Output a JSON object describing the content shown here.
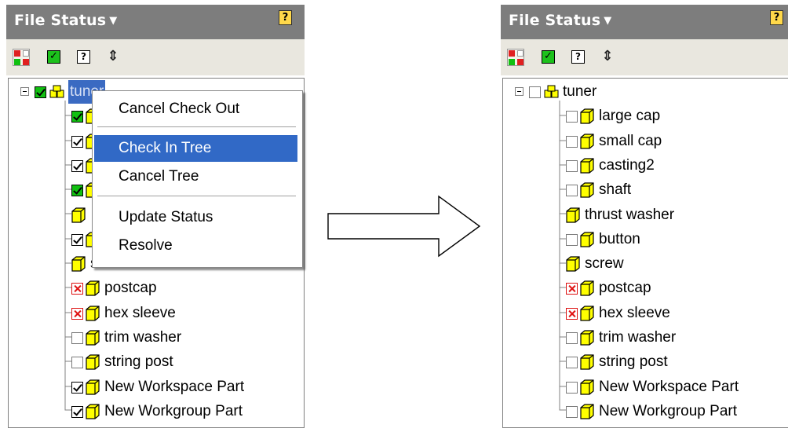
{
  "panels": {
    "left": {
      "title": "File Status",
      "help_glyph": "?",
      "toolbar": {
        "icons": [
          "status-grid-icon",
          "check-icon",
          "question-icon",
          "refresh-icon"
        ]
      },
      "tree": {
        "root": {
          "label": "tuner",
          "checkbox": "green",
          "selected": true
        },
        "items": [
          {
            "label": "",
            "checkbox": "green",
            "icon": "part"
          },
          {
            "label": "",
            "checkbox": "checked",
            "icon": "part"
          },
          {
            "label": "",
            "checkbox": "checked",
            "icon": "part"
          },
          {
            "label": "",
            "checkbox": "green",
            "icon": "part"
          },
          {
            "label": "",
            "checkbox": "none",
            "icon": "part"
          },
          {
            "label": "",
            "checkbox": "checked",
            "icon": "part"
          },
          {
            "label": "screw",
            "checkbox": "none",
            "icon": "part"
          },
          {
            "label": "postcap",
            "checkbox": "x",
            "icon": "part"
          },
          {
            "label": "hex sleeve",
            "checkbox": "x",
            "icon": "part"
          },
          {
            "label": "trim washer",
            "checkbox": "empty",
            "icon": "part"
          },
          {
            "label": "string post",
            "checkbox": "empty",
            "icon": "part"
          },
          {
            "label": "New Workspace Part",
            "checkbox": "checked",
            "icon": "part"
          },
          {
            "label": "New Workgroup Part",
            "checkbox": "checked",
            "icon": "part"
          }
        ]
      },
      "context_menu": {
        "items": [
          "Cancel Check Out",
          "Check In Tree",
          "Cancel Tree",
          "Update Status",
          "Resolve"
        ],
        "selected": "Check In Tree"
      }
    },
    "right": {
      "title": "File Status",
      "help_glyph": "?",
      "toolbar": {
        "icons": [
          "status-grid-icon",
          "check-icon",
          "question-icon",
          "refresh-icon"
        ]
      },
      "tree": {
        "root": {
          "label": "tuner",
          "checkbox": "empty"
        },
        "items": [
          {
            "label": "large cap",
            "checkbox": "empty"
          },
          {
            "label": "small cap",
            "checkbox": "empty"
          },
          {
            "label": "casting2",
            "checkbox": "empty"
          },
          {
            "label": "shaft",
            "checkbox": "empty"
          },
          {
            "label": "thrust washer",
            "checkbox": "none"
          },
          {
            "label": "button",
            "checkbox": "empty"
          },
          {
            "label": "screw",
            "checkbox": "none"
          },
          {
            "label": "postcap",
            "checkbox": "x"
          },
          {
            "label": "hex sleeve",
            "checkbox": "x"
          },
          {
            "label": "trim washer",
            "checkbox": "empty"
          },
          {
            "label": "string post",
            "checkbox": "empty"
          },
          {
            "label": "New Workspace Part",
            "checkbox": "empty"
          },
          {
            "label": "New Workgroup Part",
            "checkbox": "empty"
          }
        ]
      }
    }
  },
  "colors": {
    "titlebar": "#7d7d7d",
    "toolbar": "#e9e7df",
    "selection": "#3169c6",
    "part_fill": "#ffff00",
    "status_green": "#11c011",
    "status_red": "#e01414"
  }
}
